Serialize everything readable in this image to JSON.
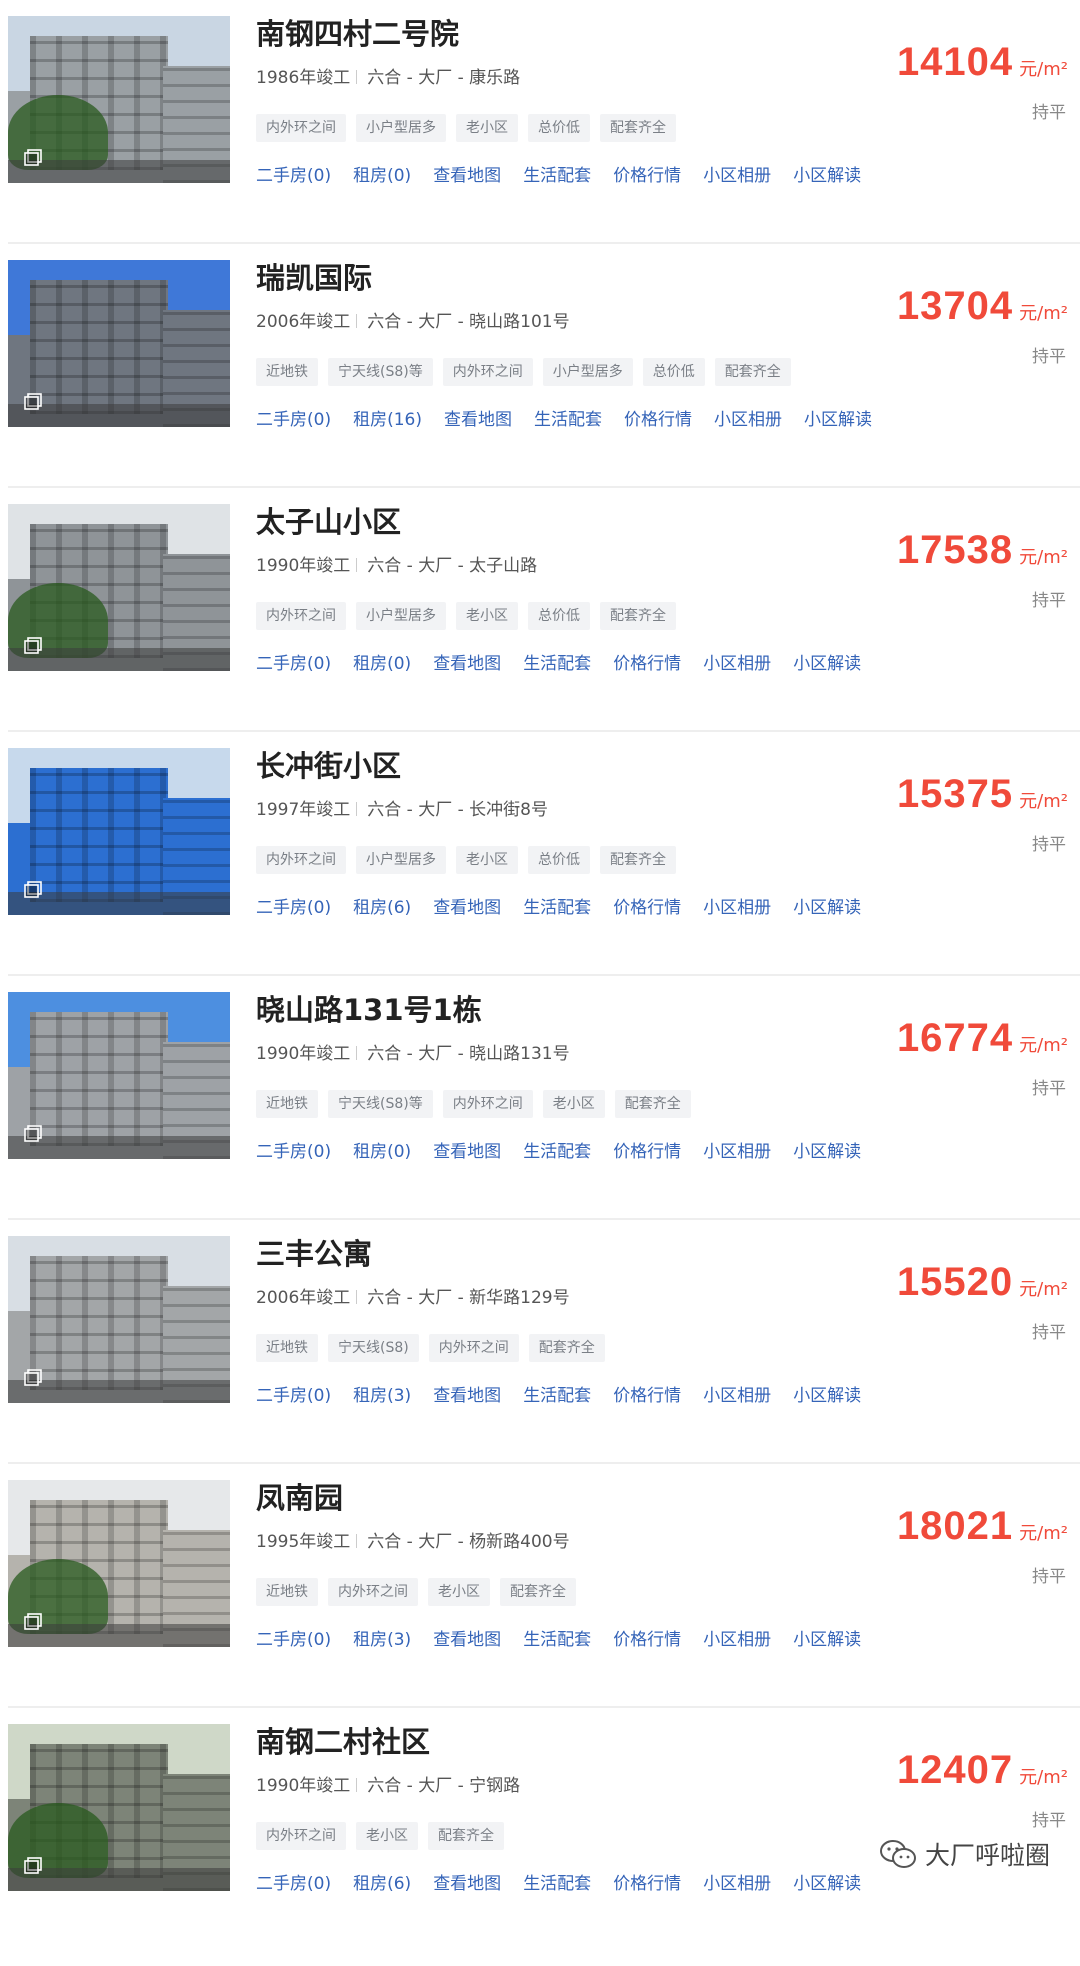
{
  "listings": [
    {
      "name": "南钢四村二号院",
      "year": "1986年竣工",
      "location": "六合 - 大厂 - 康乐路",
      "tags": [
        "内外环之间",
        "小户型居多",
        "老小区",
        "总价低",
        "配套齐全"
      ],
      "links": [
        "二手房(0)",
        "租房(0)",
        "查看地图",
        "生活配套",
        "价格行情",
        "小区相册",
        "小区解读"
      ],
      "price": "14104",
      "unit": "元/m²",
      "trend": "持平",
      "photo": {
        "sky": "#c9d6e3",
        "base": "#9aa0a4",
        "tree": true
      }
    },
    {
      "name": "瑞凯国际",
      "year": "2006年竣工",
      "location": "六合 - 大厂 - 晓山路101号",
      "tags": [
        "近地铁",
        "宁天线(S8)等",
        "内外环之间",
        "小户型居多",
        "总价低",
        "配套齐全"
      ],
      "links": [
        "二手房(0)",
        "租房(16)",
        "查看地图",
        "生活配套",
        "价格行情",
        "小区相册",
        "小区解读"
      ],
      "price": "13704",
      "unit": "元/m²",
      "trend": "持平",
      "photo": {
        "sky": "#3f78d8",
        "base": "#6f7680",
        "tree": false
      }
    },
    {
      "name": "太子山小区",
      "year": "1990年竣工",
      "location": "六合 - 大厂 - 太子山路",
      "tags": [
        "内外环之间",
        "小户型居多",
        "老小区",
        "总价低",
        "配套齐全"
      ],
      "links": [
        "二手房(0)",
        "租房(0)",
        "查看地图",
        "生活配套",
        "价格行情",
        "小区相册",
        "小区解读"
      ],
      "price": "17538",
      "unit": "元/m²",
      "trend": "持平",
      "photo": {
        "sky": "#dfe3e6",
        "base": "#8f9498",
        "tree": true
      }
    },
    {
      "name": "长冲街小区",
      "year": "1997年竣工",
      "location": "六合 - 大厂 - 长冲街8号",
      "tags": [
        "内外环之间",
        "小户型居多",
        "老小区",
        "总价低",
        "配套齐全"
      ],
      "links": [
        "二手房(0)",
        "租房(6)",
        "查看地图",
        "生活配套",
        "价格行情",
        "小区相册",
        "小区解读"
      ],
      "price": "15375",
      "unit": "元/m²",
      "trend": "持平",
      "photo": {
        "sky": "#c7d9ec",
        "base": "#2c6fd1",
        "tree": false
      }
    },
    {
      "name": "晓山路131号1栋",
      "year": "1990年竣工",
      "location": "六合 - 大厂 - 晓山路131号",
      "tags": [
        "近地铁",
        "宁天线(S8)等",
        "内外环之间",
        "老小区",
        "配套齐全"
      ],
      "links": [
        "二手房(0)",
        "租房(0)",
        "查看地图",
        "生活配套",
        "价格行情",
        "小区相册",
        "小区解读"
      ],
      "price": "16774",
      "unit": "元/m²",
      "trend": "持平",
      "photo": {
        "sky": "#4d8fe0",
        "base": "#9ea2a6",
        "tree": false
      }
    },
    {
      "name": "三丰公寓",
      "year": "2006年竣工",
      "location": "六合 - 大厂 - 新华路129号",
      "tags": [
        "近地铁",
        "宁天线(S8)",
        "内外环之间",
        "配套齐全"
      ],
      "links": [
        "二手房(0)",
        "租房(3)",
        "查看地图",
        "生活配套",
        "价格行情",
        "小区相册",
        "小区解读"
      ],
      "price": "15520",
      "unit": "元/m²",
      "trend": "持平",
      "photo": {
        "sky": "#d8dee4",
        "base": "#a3a6a8",
        "tree": false
      }
    },
    {
      "name": "凤南园",
      "year": "1995年竣工",
      "location": "六合 - 大厂 - 杨新路400号",
      "tags": [
        "近地铁",
        "内外环之间",
        "老小区",
        "配套齐全"
      ],
      "links": [
        "二手房(0)",
        "租房(3)",
        "查看地图",
        "生活配套",
        "价格行情",
        "小区相册",
        "小区解读"
      ],
      "price": "18021",
      "unit": "元/m²",
      "trend": "持平",
      "photo": {
        "sky": "#e6e8ea",
        "base": "#b5b3ad",
        "tree": true
      }
    },
    {
      "name": "南钢二村社区",
      "year": "1990年竣工",
      "location": "六合 - 大厂 - 宁钢路",
      "tags": [
        "内外环之间",
        "老小区",
        "配套齐全"
      ],
      "links": [
        "二手房(0)",
        "租房(6)",
        "查看地图",
        "生活配套",
        "价格行情",
        "小区相册",
        "小区解读"
      ],
      "price": "12407",
      "unit": "元/m²",
      "trend": "持平",
      "photo": {
        "sky": "#cfd8c8",
        "base": "#7d8478",
        "tree": true
      }
    }
  ],
  "watermark": {
    "text": "大厂呼啦圈",
    "icon": "wechat-icon"
  },
  "colors": {
    "price": "#f04a3a",
    "link": "#3564b8",
    "tag_bg": "#f2f3f5"
  }
}
